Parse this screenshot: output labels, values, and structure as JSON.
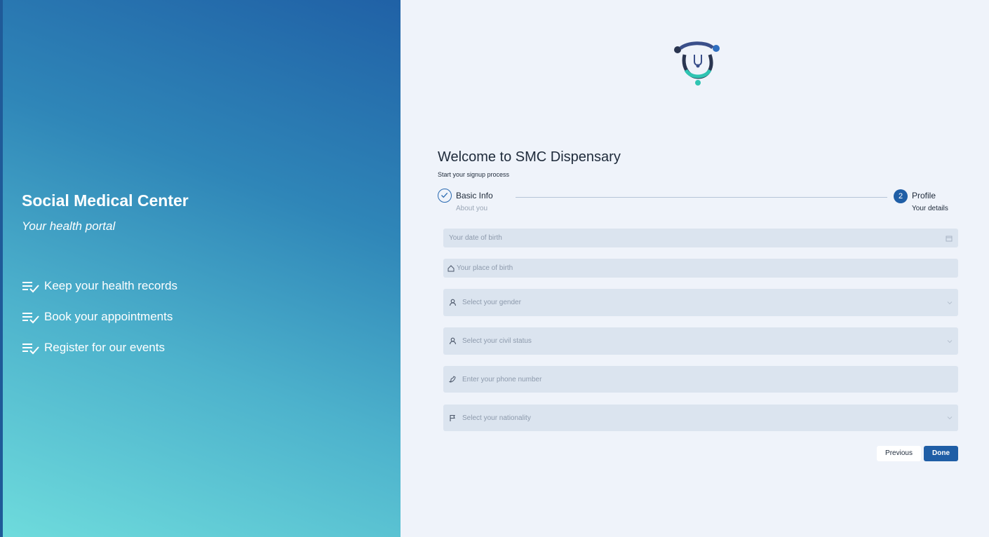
{
  "brand": {
    "title": "Social Medical Center",
    "subtitle": "Your health portal"
  },
  "features": [
    {
      "label": "Keep your health records",
      "icon": "list-check-icon"
    },
    {
      "label": "Book your appointments",
      "icon": "list-check-icon"
    },
    {
      "label": "Register for our events",
      "icon": "list-check-icon"
    }
  ],
  "form": {
    "title": "Welcome to SMC Dispensary",
    "subtitle": "Start your signup process",
    "steps": [
      {
        "label": "Basic Info",
        "description": "About you",
        "status": "completed"
      },
      {
        "number": "2",
        "label": "Profile",
        "description": "Your details",
        "status": "active"
      }
    ],
    "fields": {
      "dob": {
        "placeholder": "Your date of birth",
        "icon": "calendar-icon"
      },
      "birthplace": {
        "placeholder": "Your place of birth",
        "icon": "home-icon"
      },
      "gender": {
        "placeholder": "Select your gender",
        "icon": "user-icon"
      },
      "civil": {
        "placeholder": "Select your civil status",
        "icon": "user-icon"
      },
      "phone": {
        "placeholder": "Enter your phone number",
        "icon": "phone-icon"
      },
      "nationality": {
        "placeholder": "Select your nationality",
        "icon": "flag-icon"
      }
    },
    "buttons": {
      "previous": "Previous",
      "done": "Done"
    }
  },
  "colors": {
    "primary": "#1f5ea6",
    "panel_bg": "#eff3fa",
    "field_bg": "#dbe4ef",
    "accent_teal": "#2fc4b2"
  }
}
